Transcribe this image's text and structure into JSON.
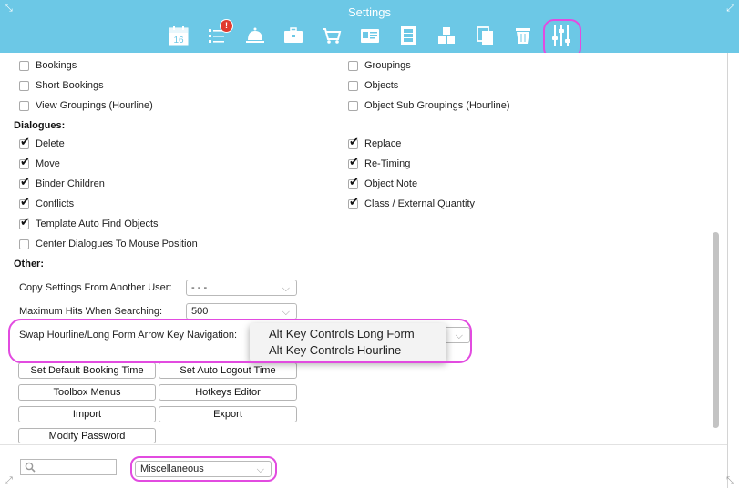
{
  "window": {
    "title": "Settings"
  },
  "toolbar": {
    "icons": [
      {
        "name": "calendar-icon",
        "text": "16"
      },
      {
        "name": "task-list-icon",
        "badge": "!"
      },
      {
        "name": "service-bell-icon"
      },
      {
        "name": "briefcase-icon"
      },
      {
        "name": "shopping-cart-icon"
      },
      {
        "name": "id-card-icon"
      },
      {
        "name": "film-strip-icon"
      },
      {
        "name": "cubes-icon"
      },
      {
        "name": "copy-pages-icon"
      },
      {
        "name": "trash-icon"
      },
      {
        "name": "sliders-icon",
        "selected": true
      }
    ]
  },
  "top_checkboxes": {
    "left": [
      {
        "label": "Bookings",
        "checked": false
      },
      {
        "label": "Short Bookings",
        "checked": false
      },
      {
        "label": "View Groupings (Hourline)",
        "checked": false
      }
    ],
    "right": [
      {
        "label": "Groupings",
        "checked": false
      },
      {
        "label": "Objects",
        "checked": false
      },
      {
        "label": "Object Sub Groupings (Hourline)",
        "checked": false
      }
    ]
  },
  "dialogues": {
    "title": "Dialogues:",
    "left": [
      {
        "label": "Delete",
        "checked": true
      },
      {
        "label": "Move",
        "checked": true
      },
      {
        "label": "Binder Children",
        "checked": true
      },
      {
        "label": "Conflicts",
        "checked": true
      },
      {
        "label": "Template Auto Find Objects",
        "checked": true
      },
      {
        "label": "Center Dialogues To Mouse Position",
        "checked": false
      }
    ],
    "right": [
      {
        "label": "Replace",
        "checked": true
      },
      {
        "label": "Re-Timing",
        "checked": true
      },
      {
        "label": "Object Note",
        "checked": true
      },
      {
        "label": "Class / External Quantity",
        "checked": true
      }
    ]
  },
  "other": {
    "title": "Other:",
    "copy_settings": {
      "label": "Copy Settings From Another User:",
      "value": "- - -"
    },
    "max_hits": {
      "label": "Maximum Hits When Searching:",
      "value": "500"
    },
    "swap_nav": {
      "label": "Swap Hourline/Long Form Arrow Key Navigation:"
    },
    "swap_options": [
      "Alt Key Controls Long Form",
      "Alt Key Controls Hourline"
    ],
    "buttons": [
      "Set Default Booking Time",
      "Set Auto Logout Time",
      "Toolbox Menus",
      "Hotkeys Editor",
      "Import",
      "Export",
      "Modify Password"
    ]
  },
  "footer": {
    "search_placeholder": "",
    "category_value": "Miscellaneous"
  },
  "colors": {
    "accent": "#6cc8e6",
    "highlight": "#e24be0"
  }
}
